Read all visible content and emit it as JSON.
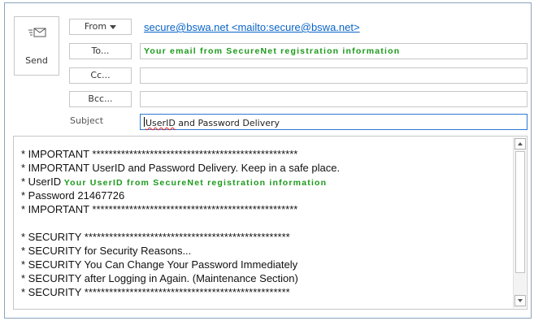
{
  "send": {
    "label": "Send",
    "icon": "send-icon"
  },
  "header": {
    "from_label": "From",
    "to_label": "To...",
    "cc_label": "Cc...",
    "bcc_label": "Bcc...",
    "subject_label": "Subject",
    "from_value": "secure@bswa.net <mailto:secure@bswa.net>",
    "to_value": "Your email from SecureNet registration information",
    "cc_value": "",
    "bcc_value": "",
    "subject_prefix": "UserID",
    "subject_rest": " and Password Delivery"
  },
  "body": {
    "line1": "* IMPORTANT **************************************************",
    "line2": "* IMPORTANT UserID and Password Delivery. Keep in a safe place.",
    "line3_prefix": "* UserID ",
    "line3_value": "Your UserID from SecureNet registration information",
    "line4": "* Password  21467726",
    "line5": "* IMPORTANT **************************************************",
    "line6": "",
    "line7": "* SECURITY **************************************************",
    "line8": "* SECURITY for Security Reasons...",
    "line9": "* SECURITY You Can Change Your Password Immediately",
    "line10": "* SECURITY after Logging in Again. (Maintenance Section)",
    "line11": "* SECURITY **************************************************"
  },
  "colors": {
    "link": "#0a64c8",
    "green_text": "#1a9a1a",
    "active_border": "#2b79d0"
  }
}
